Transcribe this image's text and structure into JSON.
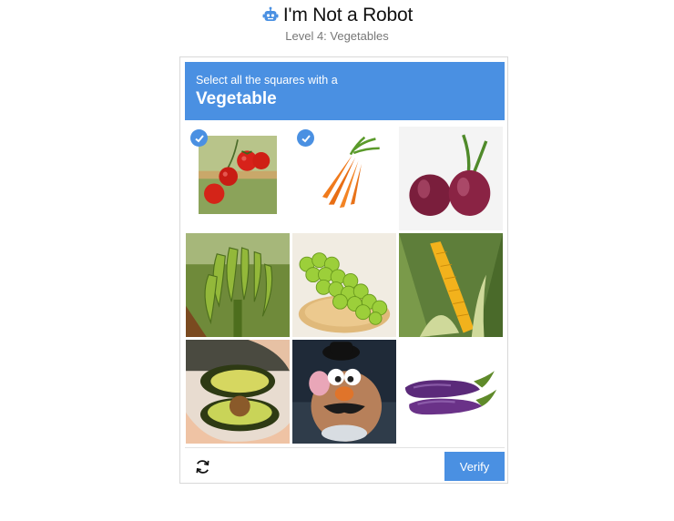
{
  "header": {
    "title": "I'm Not a Robot",
    "subtitle": "Level 4: Vegetables",
    "icon": "robot-icon"
  },
  "challenge": {
    "prompt": "Select all the squares with a",
    "target": "Vegetable",
    "accent_color": "#4a90e2"
  },
  "tiles": [
    {
      "subject": "tomatoes",
      "selected": true
    },
    {
      "subject": "carrots",
      "selected": true
    },
    {
      "subject": "red onions",
      "selected": false
    },
    {
      "subject": "green bananas",
      "selected": false
    },
    {
      "subject": "green grapes",
      "selected": false
    },
    {
      "subject": "corn",
      "selected": false
    },
    {
      "subject": "avocado",
      "selected": false
    },
    {
      "subject": "mr. potato head toy",
      "selected": false
    },
    {
      "subject": "eggplants",
      "selected": false
    }
  ],
  "footer": {
    "reload_icon": "reload-icon",
    "verify_label": "Verify"
  }
}
